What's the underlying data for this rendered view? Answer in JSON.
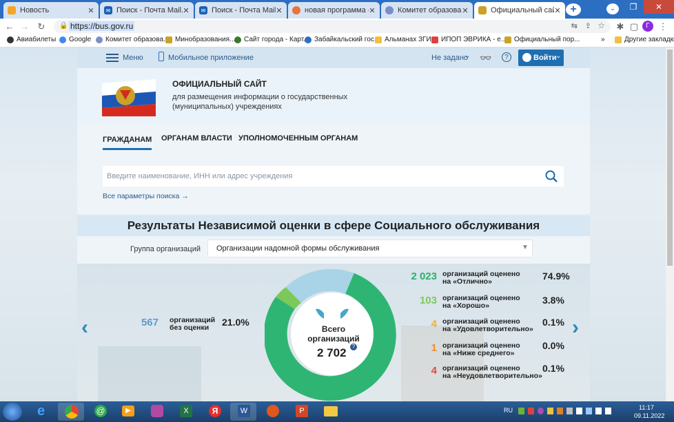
{
  "browser": {
    "tabs": [
      {
        "title": "Новость",
        "color": "#f5a623"
      },
      {
        "title": "Поиск - Почта Mail.ru",
        "color": "#1a5fb4"
      },
      {
        "title": "Поиск - Почта Mail.ru",
        "color": "#1a5fb4"
      },
      {
        "title": "новая программа — кол",
        "color": "#e8743b"
      },
      {
        "title": "Комитет образования ад",
        "color": "#7a8fc9"
      },
      {
        "title": "Официальный сайт для р",
        "color": "#c9a227",
        "active": true
      }
    ],
    "url": "https://bus.gov.ru",
    "bookmarks": [
      {
        "label": "Авиабилеты",
        "color": "#333"
      },
      {
        "label": "Google",
        "color": "#4285f4"
      },
      {
        "label": "Комитет образова...",
        "color": "#7a8fc9"
      },
      {
        "label": "Минобразования...",
        "color": "#c9a227"
      },
      {
        "label": "Сайт города - Карт...",
        "color": "#3a7a2a"
      },
      {
        "label": "Забайкальский гос...",
        "color": "#2b6ec2"
      },
      {
        "label": "Альманах ЗГИ",
        "color": "#f0c040"
      },
      {
        "label": "ИПОП ЭВРИКА - е...",
        "color": "#e04040"
      },
      {
        "label": "Официальный пор...",
        "color": "#c9a227"
      }
    ],
    "bookmarks_more": "»",
    "other_bookmarks": "Другие закладки",
    "avatar_letter": "Г"
  },
  "site": {
    "menu_label": "Меню",
    "mobile_label": "Мобильное приложение",
    "region_label": "Не задано",
    "login_label": "Войти",
    "title": "ОФИЦИАЛЬНЫЙ САЙТ",
    "subtitle_line1": "для размещения информации о государственных",
    "subtitle_line2": "(муниципальных) учреждениях",
    "nav_tabs": [
      "ГРАЖДАНАМ",
      "ОРГАНАМ ВЛАСТИ",
      "УПОЛНОМОЧЕННЫМ ОРГАНАМ"
    ],
    "search_placeholder": "Введите наименование, ИНН или адрес учреждения",
    "all_search_params": "Все параметры поиска →",
    "results_title": "Результаты Независимой оценки в сфере Социального обслуживания",
    "group_label": "Группа организаций",
    "group_value": "Организации надомной формы обслуживания",
    "total_label_1": "Всего",
    "total_label_2": "организаций",
    "total_value": "2 702",
    "left_stat": {
      "value": "567",
      "label1": "организаций",
      "label2": "без оценки",
      "pct": "21.0%",
      "color": "#5b9ec9"
    },
    "right_stats": [
      {
        "value": "2 023",
        "label1": "организаций оценено",
        "label2": "на «Отлично»",
        "pct": "74.9%",
        "color": "#2fae6e"
      },
      {
        "value": "103",
        "label1": "организаций оценено",
        "label2": "на «Хорошо»",
        "pct": "3.8%",
        "color": "#7cc85a"
      },
      {
        "value": "4",
        "label1": "организаций оценено",
        "label2": "на «Удовлетворительно»",
        "pct": "0.1%",
        "color": "#f0b429"
      },
      {
        "value": "1",
        "label1": "организаций оценено",
        "label2": "на «Ниже среднего»",
        "pct": "0.0%",
        "color": "#f08a29"
      },
      {
        "value": "4",
        "label1": "организаций оценено",
        "label2": "на «Неудовлетворительно»",
        "pct": "0.1%",
        "color": "#e04a3f"
      }
    ]
  },
  "taskbar": {
    "lang": "RU",
    "time": "11:17",
    "date": "09.11.2022"
  }
}
